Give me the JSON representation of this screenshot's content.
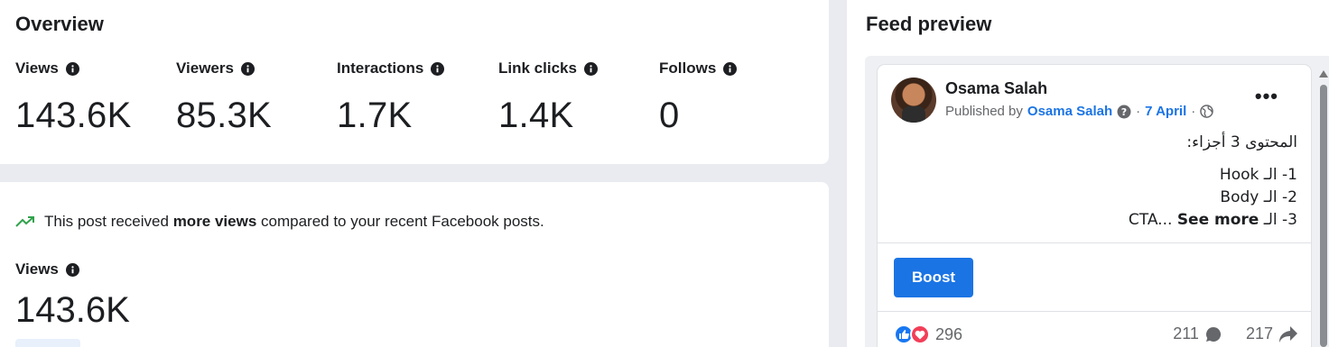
{
  "overview": {
    "title": "Overview",
    "metrics": [
      {
        "label": "Views",
        "value": "143.6K"
      },
      {
        "label": "Viewers",
        "value": "85.3K"
      },
      {
        "label": "Interactions",
        "value": "1.7K"
      },
      {
        "label": "Link clicks",
        "value": "1.4K"
      },
      {
        "label": "Follows",
        "value": "0"
      }
    ]
  },
  "summary": {
    "insight_prefix": "This post received ",
    "insight_bold": "more views",
    "insight_suffix": " compared to your recent Facebook posts.",
    "views_label": "Views",
    "views_value": "143.6K"
  },
  "feed": {
    "title": "Feed preview",
    "author": "Osama Salah",
    "published_by": "Published by",
    "publisher": "Osama Salah",
    "separator": "·",
    "date": "7 April",
    "more": "•••",
    "lines": [
      "المحتوى 3 أجزاء:",
      "1- الـ Hook",
      "2- الـ Body",
      "3- الـ CTA..."
    ],
    "see_more": "See more",
    "boost_label": "Boost",
    "reaction_count": "296",
    "comment_count": "211",
    "share_count": "217"
  },
  "colors": {
    "accent": "#1b74e4",
    "like": "#1877f2",
    "love": "#f33e58",
    "trend": "#31a24c"
  },
  "icons": [
    "info-icon",
    "trend-up-icon",
    "help-icon",
    "globe-icon",
    "like-icon",
    "love-icon",
    "comment-icon",
    "share-icon"
  ]
}
